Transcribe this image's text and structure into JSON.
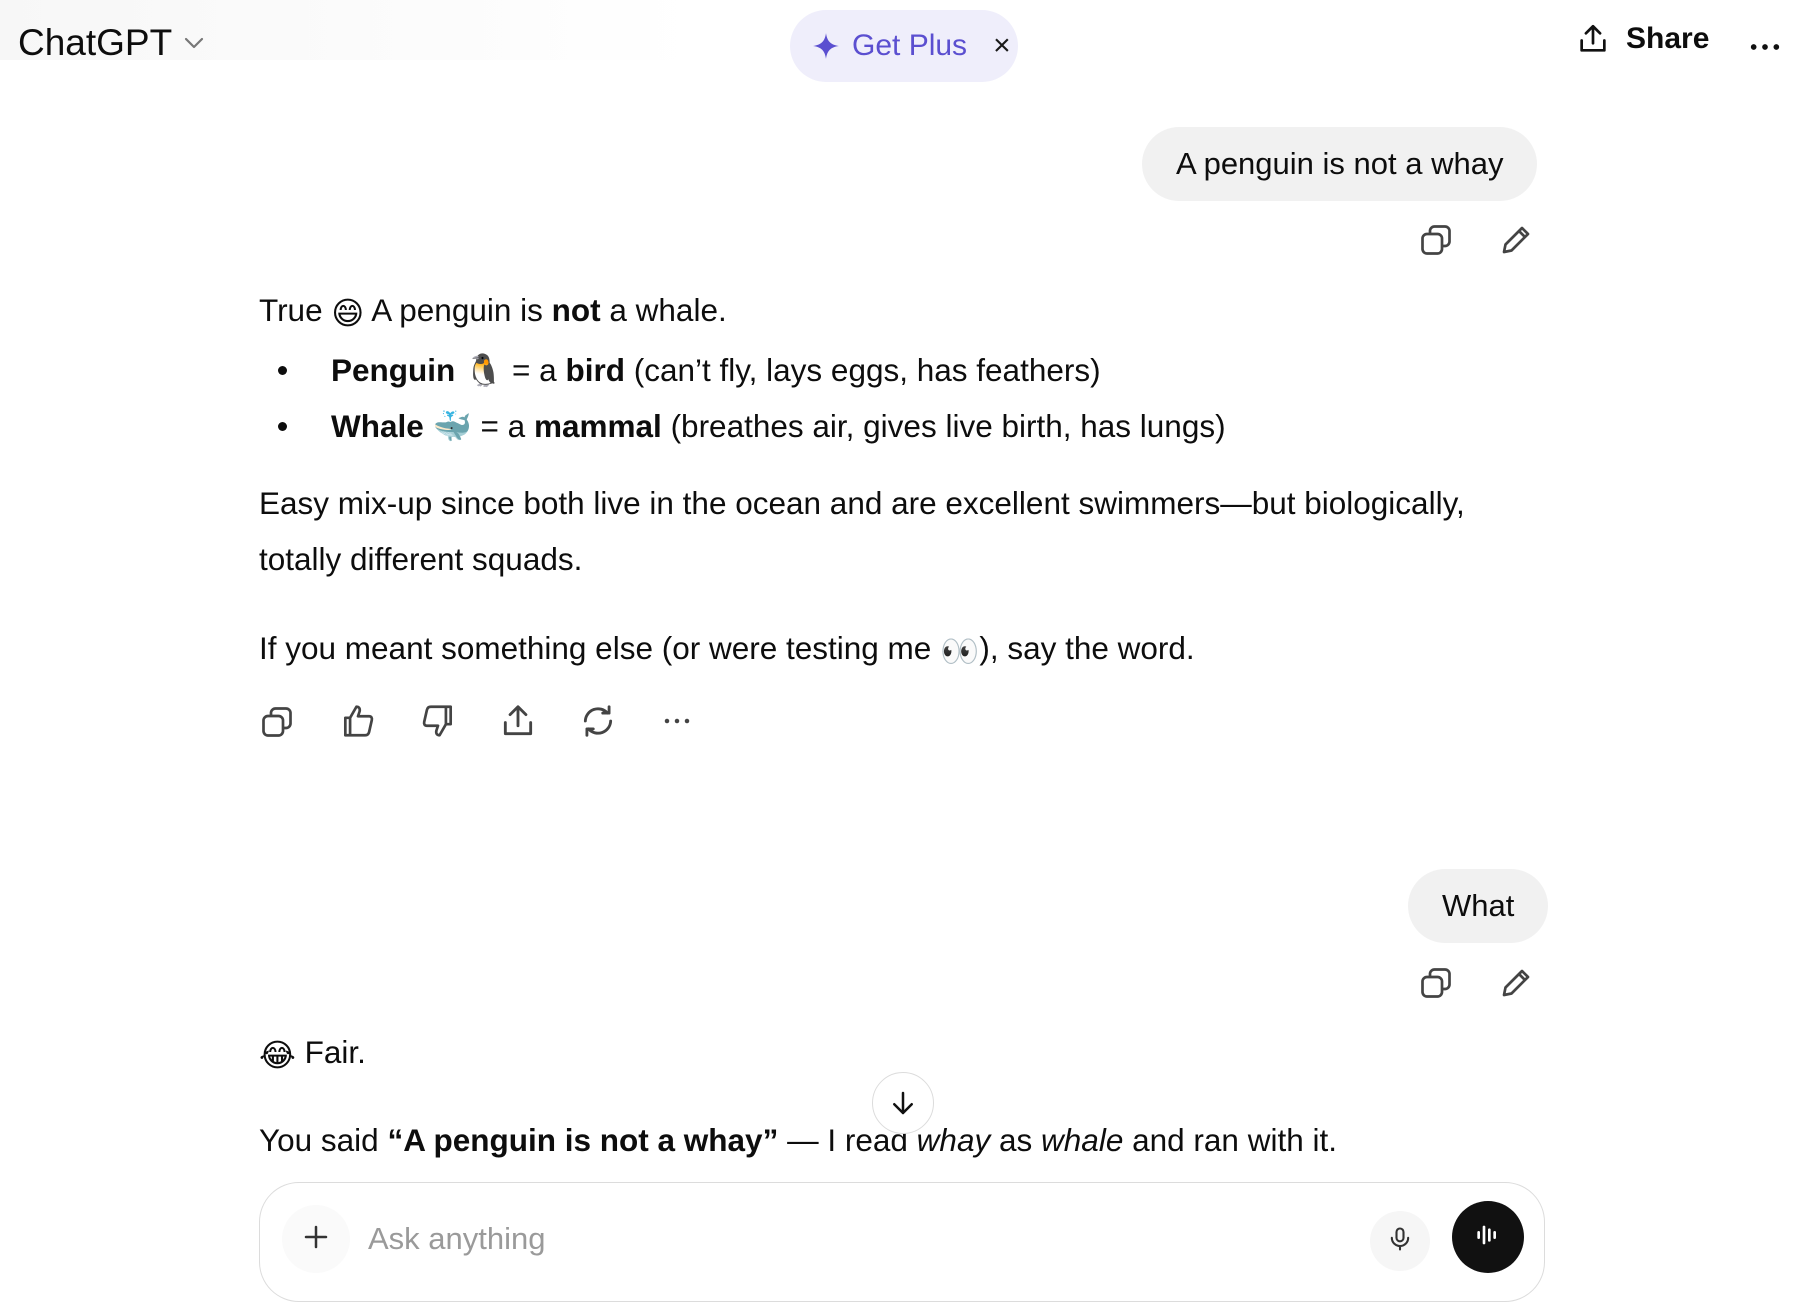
{
  "header": {
    "app_title": "ChatGPT",
    "upgrade_label": "Get Plus",
    "close_glyph": "×",
    "share_label": "Share"
  },
  "conversation": {
    "user_msg_1": "A penguin is not a whay",
    "assistant_1": {
      "intro_pre": "True",
      "intro_emoji": "😄",
      "intro_a": "A penguin is",
      "intro_bold": "not",
      "intro_b": "a whale.",
      "bullet_1": {
        "term": "Penguin",
        "emoji": "🐧",
        "eq": "= a",
        "kind": "bird",
        "detail": "(can’t fly, lays eggs, has feathers)"
      },
      "bullet_2": {
        "term": "Whale",
        "emoji": "🐳",
        "eq": "= a",
        "kind": "mammal",
        "detail": "(breathes air, gives live birth, has lungs)"
      },
      "para_1_line_1": "Easy mix-up since both live in the ocean and are excellent swimmers—but biologically,",
      "para_1_line_2": "totally different squads.",
      "para_2_a": "If you meant something else (or were testing me",
      "para_2_emoji": "👀",
      "para_2_b": "), say the word."
    },
    "user_msg_2": "What",
    "assistant_2": {
      "line_1_emoji": "😂",
      "line_1": "Fair.",
      "line_2_a": "You said",
      "line_2_quote": "“A penguin is not a whay”",
      "line_2_b": "— I read",
      "line_2_i1": "whay",
      "line_2_c": "as",
      "line_2_i2": "whale",
      "line_2_d": "and ran with it."
    }
  },
  "composer": {
    "placeholder": "Ask anything"
  },
  "icons": {
    "colors": {
      "accent": "#5b4fd0",
      "pill_bg": "#efeefb",
      "bubble_bg": "#f1f1f1"
    }
  }
}
